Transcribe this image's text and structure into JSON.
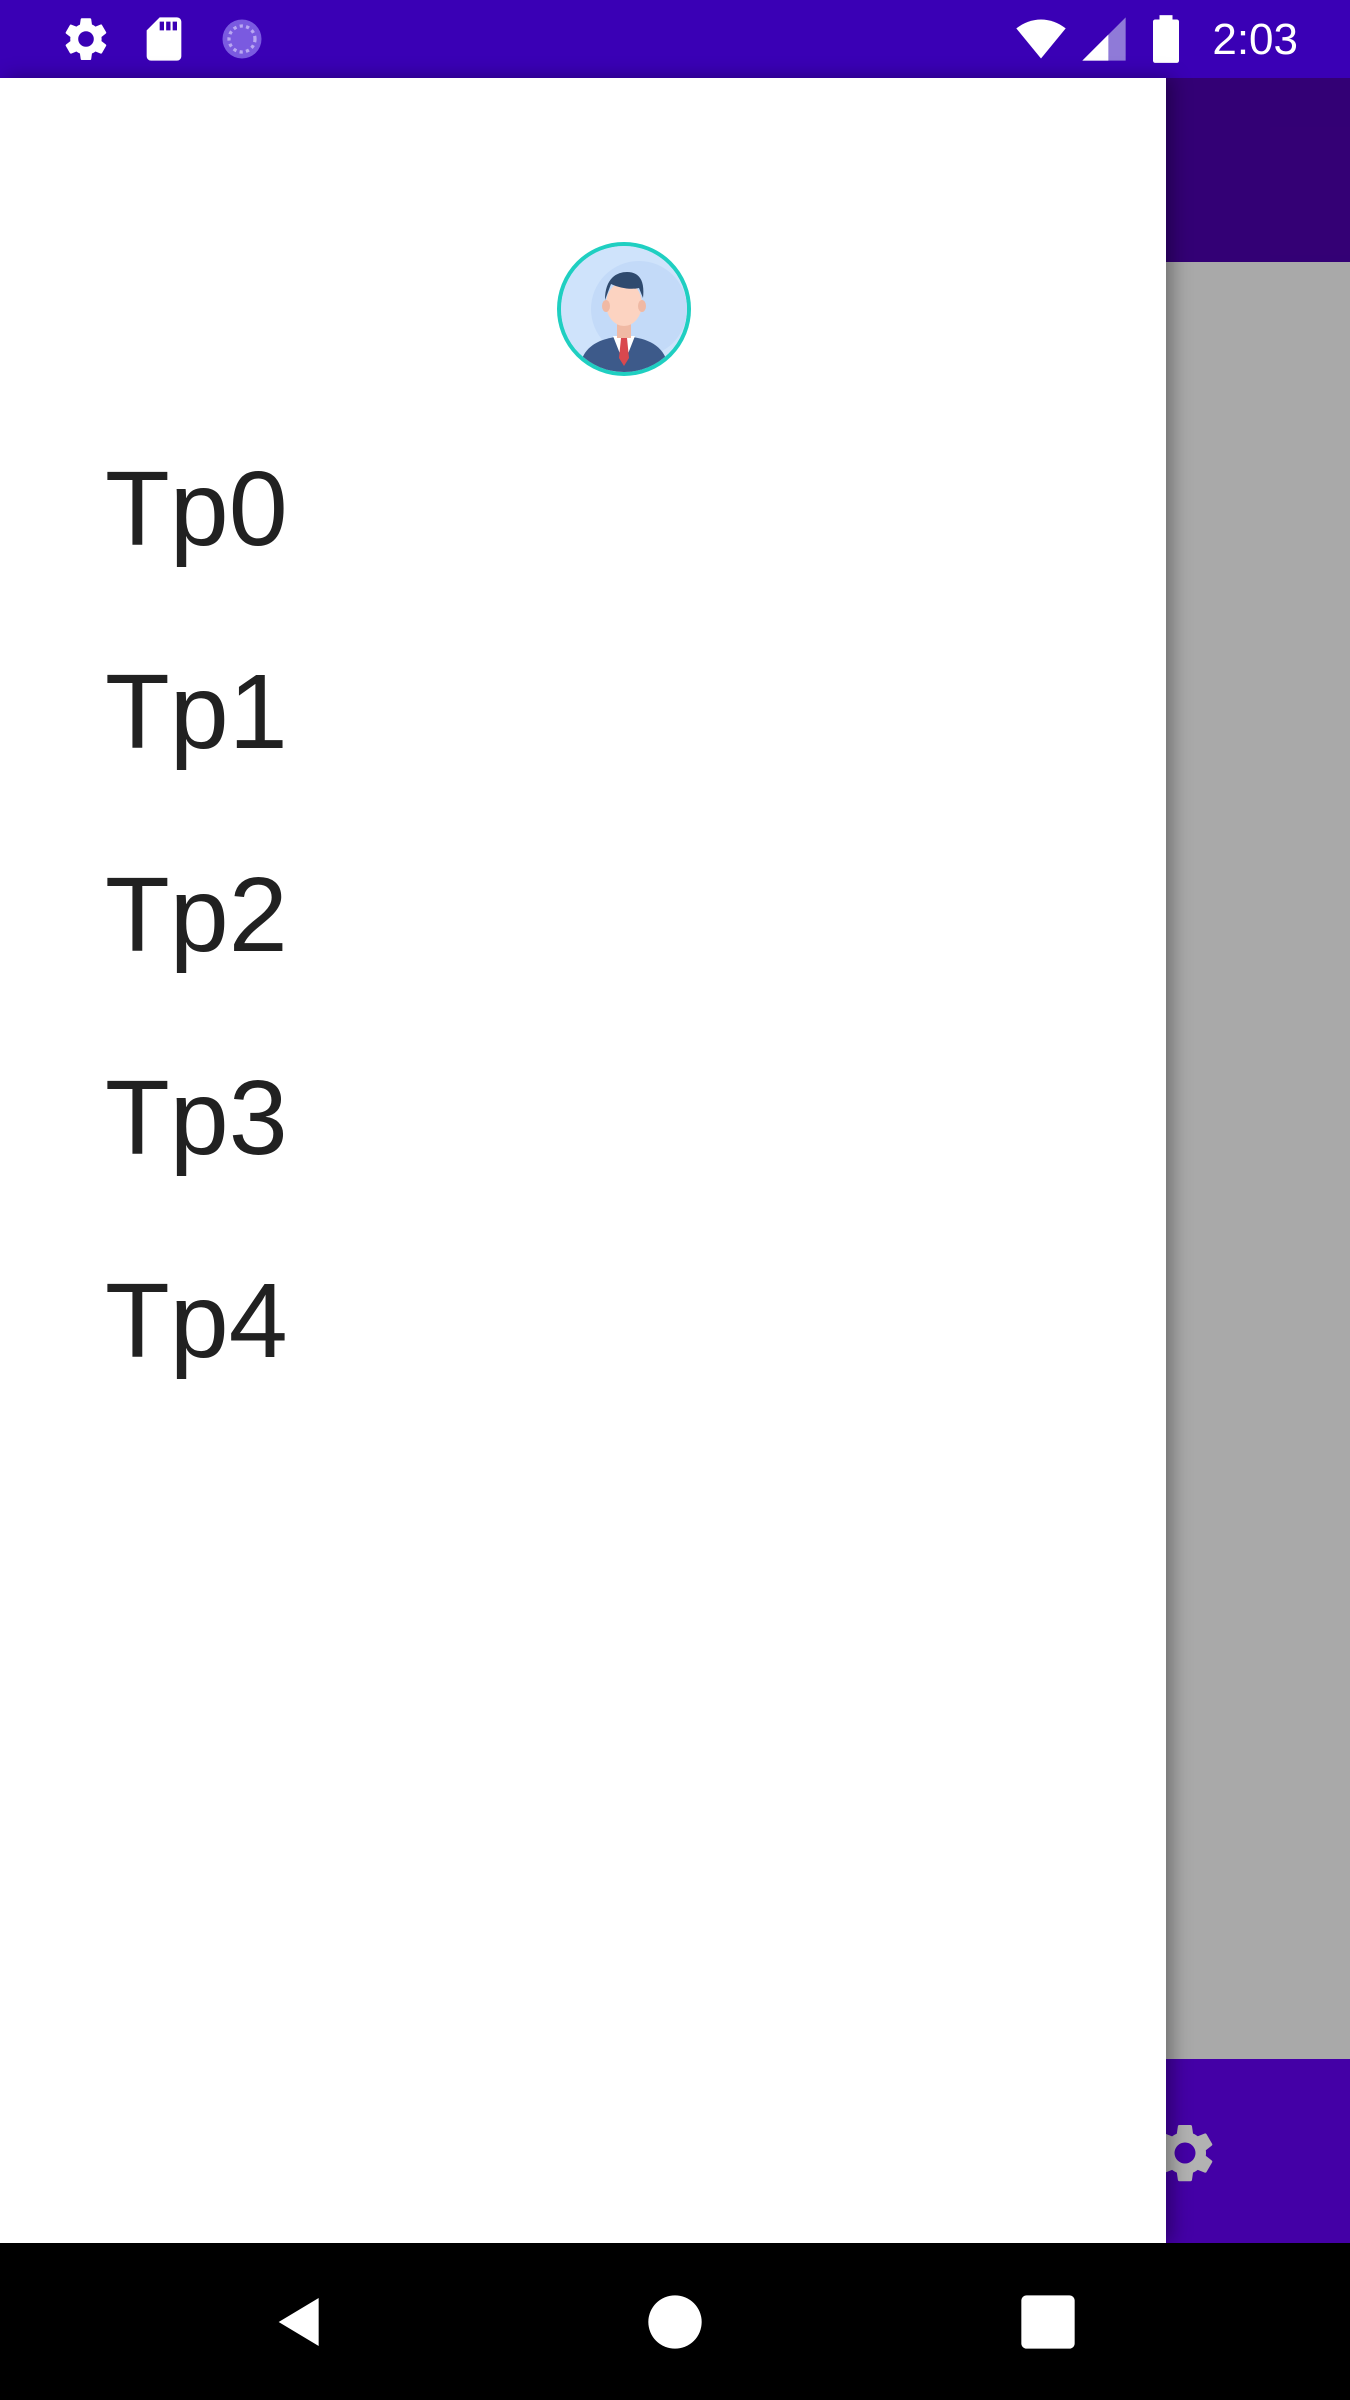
{
  "status_bar": {
    "time": "2:03",
    "left_icons": [
      "gear-icon",
      "sd-card-icon",
      "sync-icon"
    ],
    "right_icons": [
      "wifi-icon",
      "cell-signal-icon",
      "battery-icon"
    ],
    "background_color": "#3a00b5"
  },
  "drawer": {
    "avatar_icon": "businessman-avatar-icon",
    "menu_items": [
      {
        "label": "Tp0"
      },
      {
        "label": "Tp1"
      },
      {
        "label": "Tp2"
      },
      {
        "label": "Tp3"
      },
      {
        "label": "Tp4"
      }
    ]
  },
  "background_app": {
    "toolbar_color": "#4a00a8",
    "bottom_bar_color": "#6200ee",
    "bottom_bar_icon": "gear-icon"
  },
  "navigation_bar": {
    "buttons": [
      "back-icon",
      "home-icon",
      "recents-icon"
    ]
  }
}
